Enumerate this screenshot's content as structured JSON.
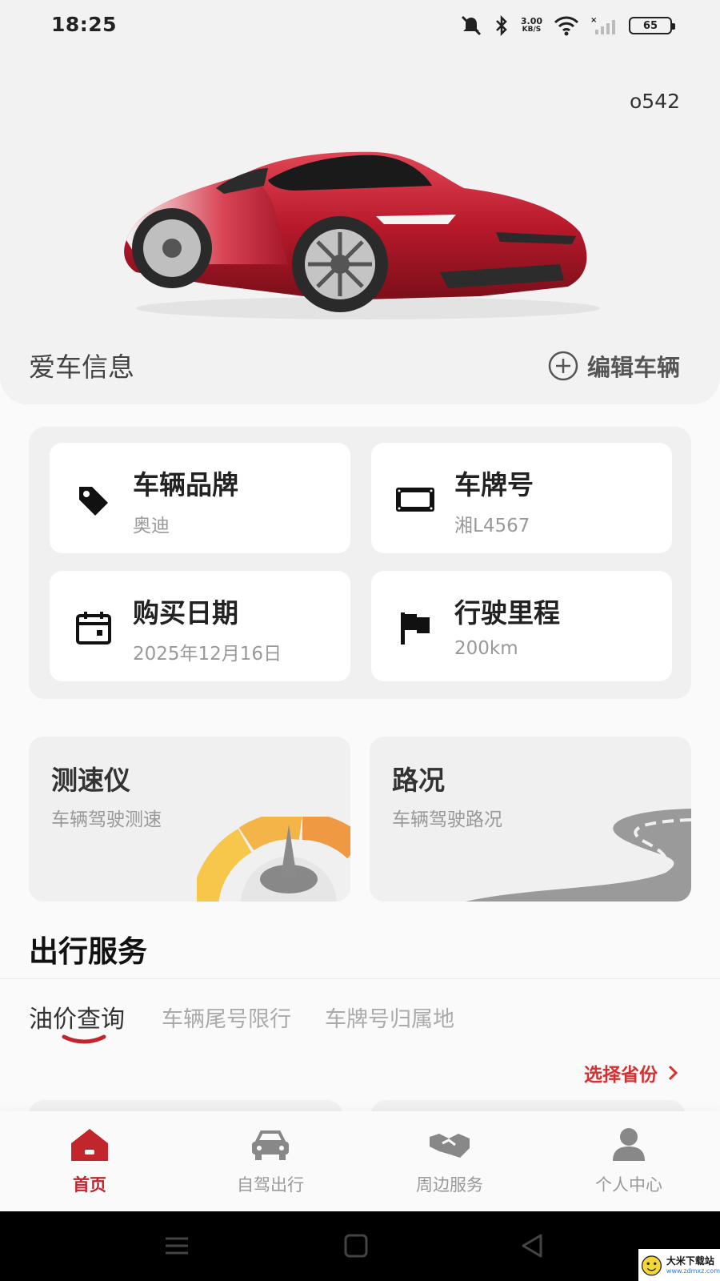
{
  "status_bar": {
    "time": "18:25",
    "network_speed_value": "3.00",
    "network_speed_unit": "KB/S",
    "battery": "65"
  },
  "hero": {
    "user_code": "o542",
    "title": "爱车信息",
    "edit_label": "编辑车辆"
  },
  "vehicle_info": [
    {
      "label": "车辆品牌",
      "value": "奥迪",
      "icon": "tag-icon"
    },
    {
      "label": "车牌号",
      "value": "湘L4567",
      "icon": "license-plate-icon"
    },
    {
      "label": "购买日期",
      "value": "2025年12月16日",
      "icon": "calendar-icon"
    },
    {
      "label": "行驶里程",
      "value": "200km",
      "icon": "flag-icon"
    }
  ],
  "features": [
    {
      "title": "测速仪",
      "subtitle": "车辆驾驶测速",
      "icon": "speedometer-illustration"
    },
    {
      "title": "路况",
      "subtitle": "车辆驾驶路况",
      "icon": "road-illustration"
    }
  ],
  "services": {
    "title": "出行服务",
    "tabs": [
      {
        "label": "油价查询",
        "active": true
      },
      {
        "label": "车辆尾号限行",
        "active": false
      },
      {
        "label": "车牌号归属地",
        "active": false
      }
    ],
    "province_select": "选择省份"
  },
  "bottom_nav": [
    {
      "label": "首页",
      "icon": "home-icon",
      "active": true
    },
    {
      "label": "自驾出行",
      "icon": "car-icon",
      "active": false
    },
    {
      "label": "周边服务",
      "icon": "handshake-icon",
      "active": false
    },
    {
      "label": "个人中心",
      "icon": "person-icon",
      "active": false
    }
  ],
  "colors": {
    "accent": "#c0262c",
    "card_bg": "#f0f0f0",
    "page_bg": "#fafafa"
  },
  "watermark": {
    "title": "大米下载站",
    "url": "www.zdmxz.com"
  }
}
